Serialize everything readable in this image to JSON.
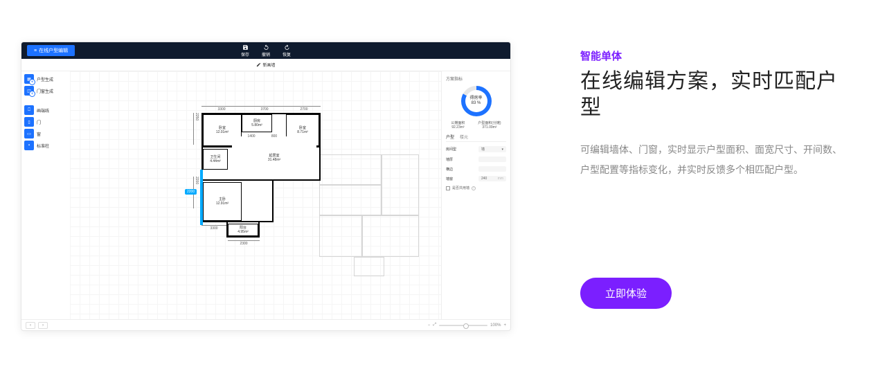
{
  "marketing": {
    "eyebrow": "智能单体",
    "headline": "在线编辑方案，实时匹配户型",
    "desc": "可编辑墙体、门窗，实时显示户型面积、面宽尺寸、开间数、户型配置等指标变化，并实时反馈多个相匹配户型。",
    "cta": "立即体验"
  },
  "app": {
    "badge": "在线户型编辑",
    "toolbar": {
      "save": "保存",
      "undo": "撤销",
      "redo": "恢复"
    },
    "subbar": {
      "wall": "新画墙"
    },
    "sidebar": {
      "items": [
        {
          "label": "户型生成"
        },
        {
          "label": "门窗生成"
        }
      ],
      "tools": [
        {
          "label": "画端线"
        },
        {
          "label": "门"
        },
        {
          "label": "窗"
        },
        {
          "label": "标准柱"
        }
      ]
    },
    "floor": {
      "dims": {
        "top1": "3300",
        "top2": "3700",
        "top3": "2700",
        "leftTotal": "2250",
        "leftMid": "2200",
        "gapSmall": "1400",
        "gap800": "800",
        "bottom1": "3300",
        "bottom2": "2300"
      },
      "rooms": {
        "bed1": {
          "name": "卧室",
          "area": "12.01m²"
        },
        "kitchen": {
          "name": "厨房",
          "area": "5.80m²"
        },
        "bed2": {
          "name": "卧室",
          "area": "8.71m²"
        },
        "bath": {
          "name": "卫生间",
          "area": "4.44m²"
        },
        "living": {
          "name": "起居室",
          "area": "31.48m²"
        },
        "master": {
          "name": "主卧",
          "area": "12.91m²"
        },
        "balcony": {
          "name": "阳台",
          "area": "4.95m²"
        }
      }
    },
    "rpanel": {
      "title": "方案指标",
      "gauge_label": "得房率",
      "gauge_value": "83 %",
      "metric1_label": "公摊面积",
      "metric1_value": "92.23m²",
      "metric2_label": "户型面积(分摊)",
      "metric2_value": "371.09m²",
      "tab_unit": "户型",
      "tab_other": "楼元",
      "field_type": "房间型",
      "field_type_val": "墙",
      "field_thick": "墙厚",
      "field_align": "横边",
      "field_width": "墙窗",
      "field_width_val": "240",
      "unit_mm": "mm",
      "chk_label": "是否共用墙"
    },
    "footer": {
      "zoom": "100%"
    }
  }
}
